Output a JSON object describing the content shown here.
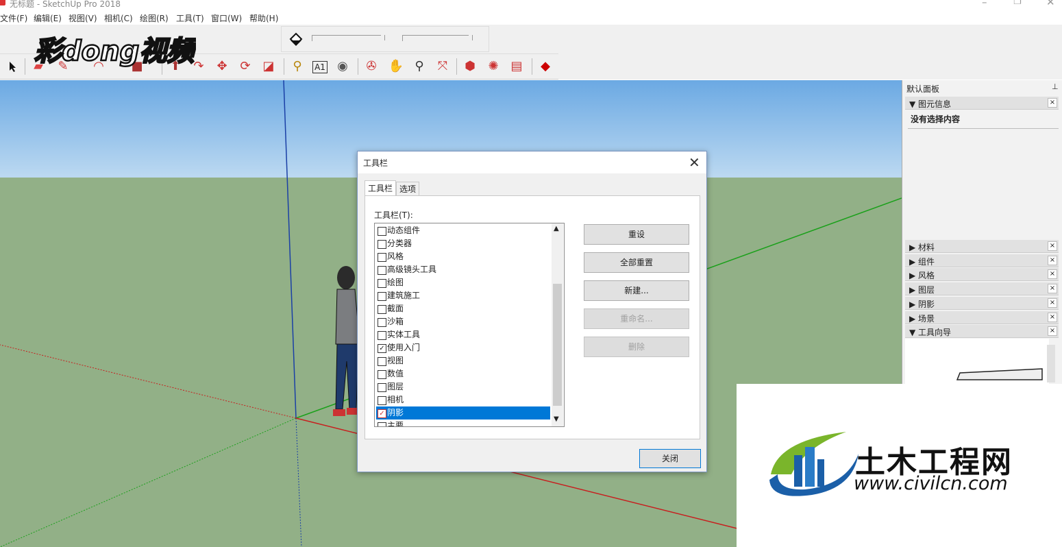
{
  "window": {
    "title": "无标题 - SketchUp Pro 2018",
    "minimize": "–",
    "restore": "❐",
    "close": "✕"
  },
  "menu": [
    "文件(F)",
    "编辑(E)",
    "视图(V)",
    "相机(C)",
    "绘图(R)",
    "工具(T)",
    "窗口(W)",
    "帮助(H)"
  ],
  "overlay": {
    "logo_text": "彩dong视频"
  },
  "toolbar_icons": [
    "select-arrow-icon",
    "eraser-icon",
    "pencil-icon",
    "arc-icon",
    "shape-icon",
    "push-pull-icon",
    "follow-me-icon",
    "move-icon",
    "rotate-icon",
    "scale-icon",
    "tape-measure-icon",
    "text-label-icon",
    "paint-bucket-icon",
    "orbit-icon",
    "pan-icon",
    "zoom-icon",
    "zoom-extents-icon",
    "warehouse-icon",
    "extension-icon",
    "layout-icon",
    "ruby-icon"
  ],
  "tray": {
    "title": "默认面板",
    "entity_info": {
      "label": "▼ 图元信息",
      "content": "没有选择内容"
    },
    "panels": [
      "▶ 材料",
      "▶ 组件",
      "▶ 风格",
      "▶ 图层",
      "▶ 阴影",
      "▶ 场景"
    ],
    "instructor": "▼ 工具向导",
    "close": "×"
  },
  "dialog": {
    "title": "工具栏",
    "close": "✕",
    "tabs": [
      "工具栏",
      "选项"
    ],
    "list_label": "工具栏(T):",
    "items": [
      {
        "label": "动态组件",
        "checked": false
      },
      {
        "label": "分类器",
        "checked": false
      },
      {
        "label": "风格",
        "checked": false
      },
      {
        "label": "高级镜头工具",
        "checked": false
      },
      {
        "label": "绘图",
        "checked": false
      },
      {
        "label": "建筑施工",
        "checked": false
      },
      {
        "label": "截面",
        "checked": false
      },
      {
        "label": "沙箱",
        "checked": false
      },
      {
        "label": "实体工具",
        "checked": false
      },
      {
        "label": "使用入门",
        "checked": true
      },
      {
        "label": "视图",
        "checked": false
      },
      {
        "label": "数值",
        "checked": false
      },
      {
        "label": "图层",
        "checked": false
      },
      {
        "label": "相机",
        "checked": false
      },
      {
        "label": "阴影",
        "checked": true,
        "selected": true
      },
      {
        "label": "主要",
        "checked": false
      }
    ],
    "buttons": [
      {
        "label": "重设",
        "enabled": true
      },
      {
        "label": "全部重置",
        "enabled": true
      },
      {
        "label": "新建...",
        "enabled": true
      },
      {
        "label": "重命名...",
        "enabled": false
      },
      {
        "label": "删除",
        "enabled": false
      }
    ],
    "close_button": "关闭"
  },
  "watermark": {
    "title": "土木工程网",
    "url": "www.civilcn.com"
  }
}
